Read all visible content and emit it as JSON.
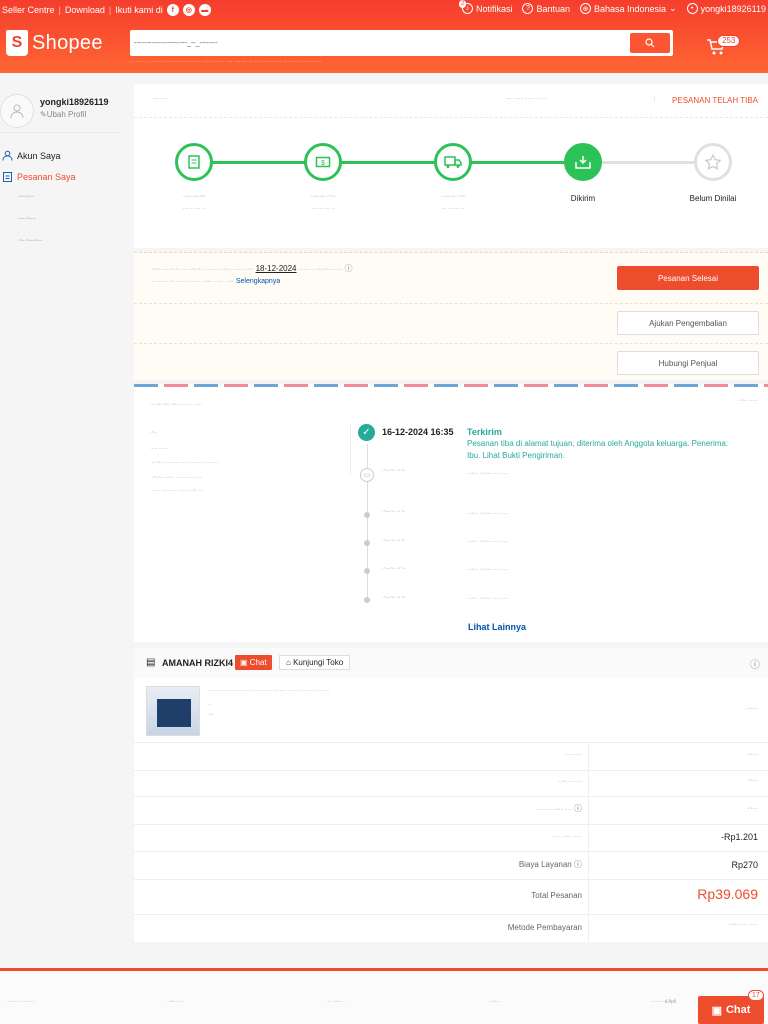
{
  "topbar": {
    "seller": "Seller Centre",
    "download": "Download",
    "follow": "Ikuti kami di",
    "notif": "Notifikasi",
    "notif_count": "2",
    "help": "Bantuan",
    "lang": "Bahasa Indonesia",
    "user": "yongki18926119"
  },
  "header": {
    "brand": "Shopee",
    "search_value": "-~---~-------~~--~-_--_-~-----",
    "search_hints": "··· ······ ·· ········ ·········· ····· ··· ····· ········ ···· ········ ··· ···· ···· ······· ·· ····· ········ ·····",
    "cart_count": "253"
  },
  "sidebar": {
    "username": "yongki18926119",
    "edit": "Ubah Profil",
    "account": "Akun Saya",
    "orders": "Pesanan Saya",
    "sub1": "·~·--~·-",
    "sub2": "·---·~--·-",
    "sub3": "·~-·~·---~·-"
  },
  "order": {
    "back": "· ·-·······-·",
    "id_text": "·-·· ······· ······· ·· ·· ··",
    "status": "PESANAN TELAH TIBA"
  },
  "steps": [
    {
      "label": "···~···~··~~·",
      "sub": "··· ··· ··· ··"
    },
    {
      "label": "···~···~···~~··",
      "sub": "··· ··· ··· ··"
    },
    {
      "label": "···~···~···~~·",
      "sub": "··· ··· ··· ··"
    },
    {
      "label": "Dikirim",
      "sub": ""
    },
    {
      "label": "Belum Dinilai",
      "sub": ""
    }
  ],
  "notice": {
    "line1": "··~·~ ·······~·~ ······ ··~··~ ·· ········· ···~··· ······ ····~·",
    "date": "18-12-2024",
    "line2": "········ ····~···~···· ·····",
    "line3": "··· ······· ···~ ······ ··· ······ ····~·· ·· ···· ····~",
    "more": "Selengkapnya",
    "btn_done": "Pesanan Selesai",
    "btn_return": "Ajukan Pengembalian",
    "btn_contact": "Hubungi Penjual"
  },
  "address": {
    "title": "····~··~· ·~······ ·· ·····",
    "right": "··~··· ······",
    "name": "·~··",
    "phone": "····· ······",
    "lines": [
      "·····~···· ········· ··· ··· ······· ·· ····· ··",
      "··~··~ ····~·· ··· ······· ·· ····",
      "······· ·········· ······· ···~ ····"
    ]
  },
  "tracking": {
    "time": "16-12-2024 16:35",
    "status": "Terkirim",
    "desc": "Pesanan tiba di alamat tujuan, diterima oleh Anggota keluarga. Penerima: Ibu.",
    "proof": "Lihat Bukti Pengiriman.",
    "more": "Lihat Lainnya",
    "items": [
      {
        "time": "·~·-·~· ·~ ~·",
        "text": "···~··· ··~·~ ···· ·······"
      },
      {
        "time": "·~·-·~· ·~ ~·",
        "text": "···~··· ··~·~ ···· ·······"
      },
      {
        "time": "·~·-·~· ·~ ~·",
        "text": "···~··· ··~·~ ···· ·······"
      },
      {
        "time": "·~·-·~· ·~ ~·",
        "text": "···~··· ··~·~ ···· ·······"
      },
      {
        "time": "·~·-·~· ·~ ~·",
        "text": "···~··· ··~·~ ···· ·······"
      }
    ]
  },
  "shop": {
    "name": "AMANAH RIZKI4",
    "chat": "Chat",
    "visit": "Kunjungi Toko",
    "product": "····· ······ ·········· ····· ····· ········ ···· ····· ········· ····· ···· ···· ···",
    "variant": "··",
    "qty": "·~·",
    "price": "···~····"
  },
  "summary": [
    {
      "label": "······ ·····",
      "value": "··~····"
    },
    {
      "label": "···~··· ········",
      "value": "··~····"
    },
    {
      "label": "······ ·······~··· ·····",
      "value": "··~····"
    },
    {
      "label": "······ ··~··· ······",
      "value": "-Rp1.201"
    },
    {
      "label": "Biaya Layanan",
      "value": "Rp270"
    },
    {
      "label": "Total Pesanan",
      "value": "Rp39.069"
    },
    {
      "label": "Metode Pembayaran",
      "value": "···~··· ····· ······"
    }
  ],
  "footer": {
    "cols": [
      "·········· ·········",
      "···~·······",
      "······~·····",
      "···~···",
      "··········d Apli"
    ]
  },
  "chat": {
    "label": "Chat",
    "count": "17"
  },
  "colors": {
    "brand": "#ee4d2d",
    "green": "#26aa99",
    "step_green": "#2dc258"
  }
}
